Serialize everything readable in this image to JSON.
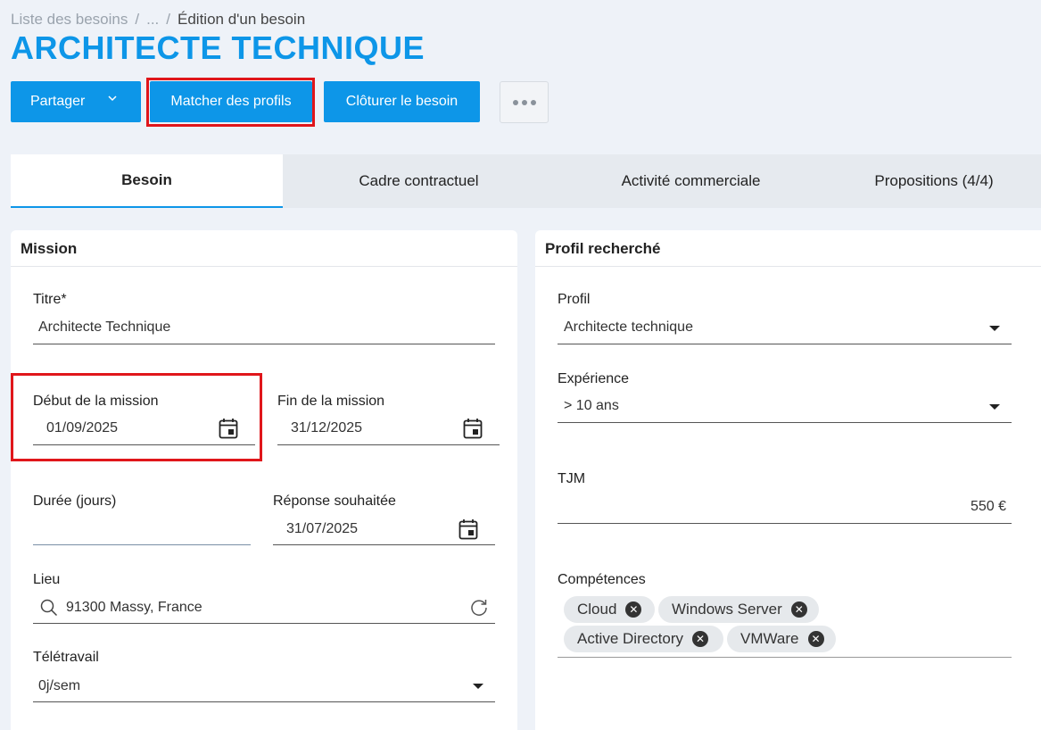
{
  "breadcrumb": {
    "root": "Liste des besoins",
    "sep1": "/",
    "ellipsis": "...",
    "sep2": "/",
    "current": "Édition d'un besoin"
  },
  "title": "ARCHITECTE TECHNIQUE",
  "toolbar": {
    "share_label": "Partager",
    "match_label": "Matcher des profils",
    "close_label": "Clôturer le besoin"
  },
  "tabs": [
    {
      "label": "Besoin",
      "active": true
    },
    {
      "label": "Cadre contractuel",
      "active": false
    },
    {
      "label": "Activité commerciale",
      "active": false
    },
    {
      "label": "Propositions (4/4)",
      "active": false
    }
  ],
  "mission": {
    "header": "Mission",
    "titre": {
      "label": "Titre*",
      "value": "Architecte Technique"
    },
    "debut": {
      "label": "Début de la mission",
      "value": "01/09/2025"
    },
    "fin": {
      "label": "Fin de la mission",
      "value": "31/12/2025"
    },
    "duree": {
      "label": "Durée (jours)",
      "value": ""
    },
    "reponse": {
      "label": "Réponse souhaitée",
      "value": "31/07/2025"
    },
    "lieu": {
      "label": "Lieu",
      "value": "91300 Massy, France"
    },
    "teletravail": {
      "label": "Télétravail",
      "value": "0j/sem"
    }
  },
  "profil": {
    "header": "Profil recherché",
    "profil": {
      "label": "Profil",
      "value": "Architecte technique"
    },
    "experience": {
      "label": "Expérience",
      "value": "> 10 ans"
    },
    "tjm": {
      "label": "TJM",
      "value": "550 €"
    },
    "competences": {
      "label": "Compétences",
      "chips": [
        "Cloud",
        "Windows Server",
        "Active Directory",
        "VMWare"
      ]
    }
  },
  "colors": {
    "accent": "#0d96e8",
    "highlight": "#e0161b"
  }
}
